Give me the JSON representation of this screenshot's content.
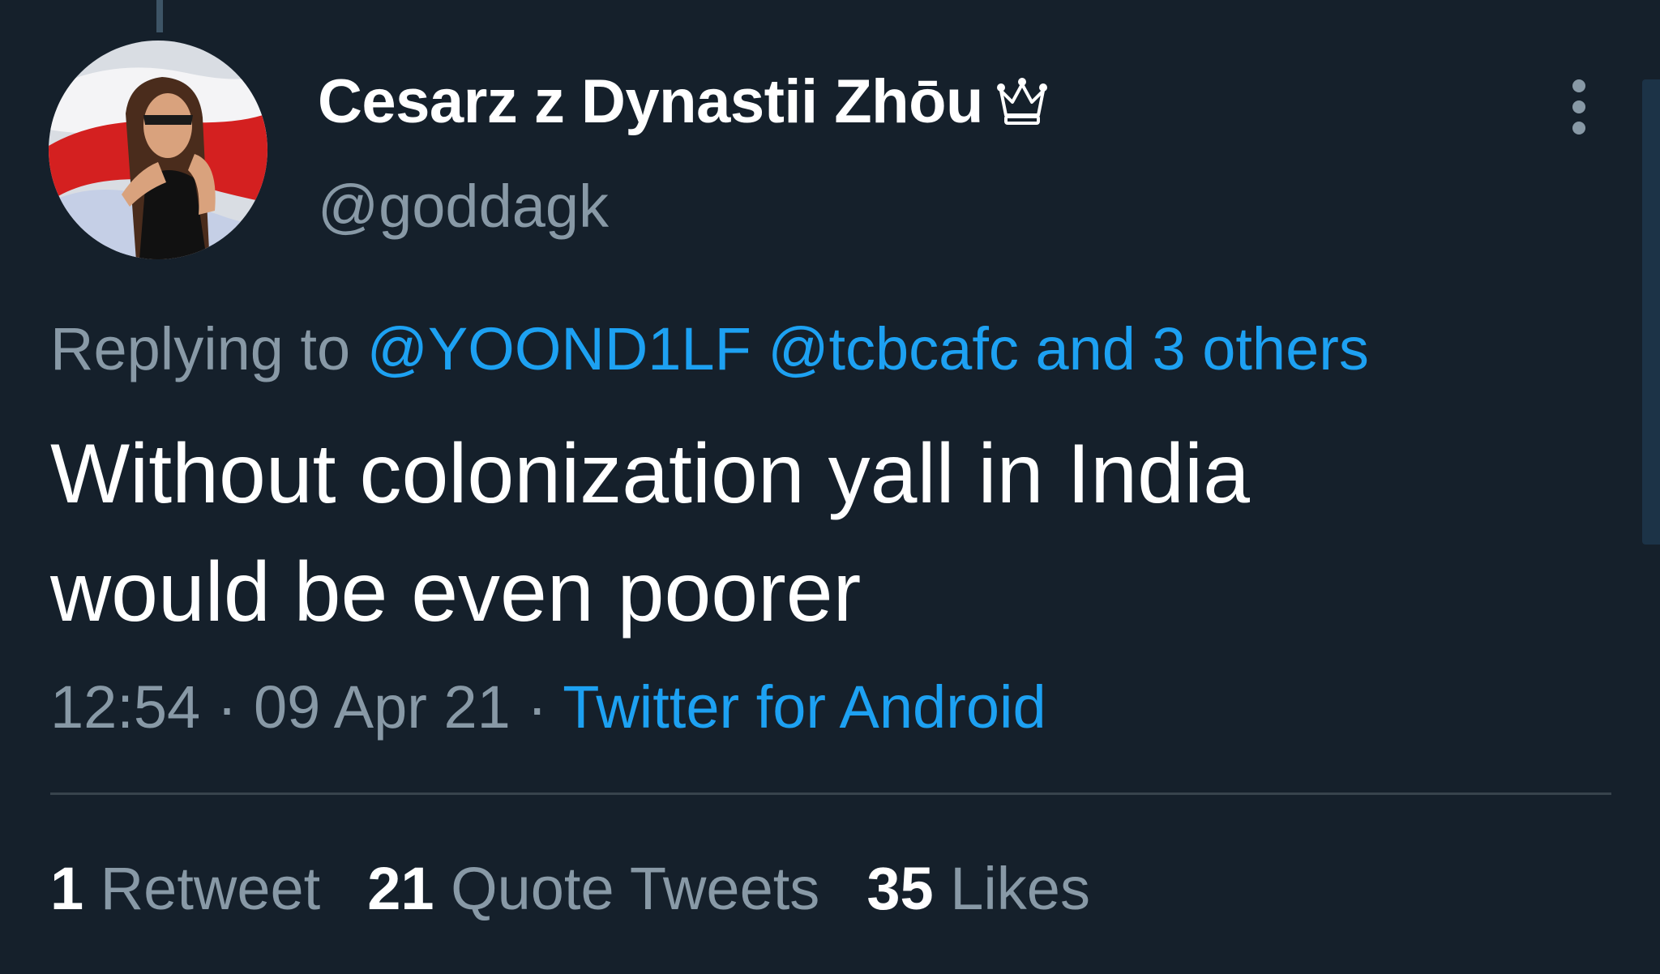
{
  "tweet": {
    "author": {
      "display_name": "Cesarz z Dynastii Zhōu",
      "handle": "@goddagk",
      "badge_icon": "crown-icon",
      "avatar": "profile-photo"
    },
    "reply": {
      "prefix": "Replying to",
      "mentions": [
        "@YOOND1LF",
        "@tcbcafc"
      ],
      "others": "and 3 others"
    },
    "text_lines": [
      "Without colonization yall in India",
      "would be even poorer"
    ],
    "time": "12:54",
    "date": "09 Apr 21",
    "separator": "·",
    "source": "Twitter for Android",
    "stats": {
      "retweets": {
        "count": "1",
        "label": "Retweet"
      },
      "quotes": {
        "count": "21",
        "label": "Quote Tweets"
      },
      "likes": {
        "count": "35",
        "label": "Likes"
      }
    }
  },
  "colors": {
    "background": "#15202b",
    "text_primary": "#ffffff",
    "text_secondary": "#8899a6",
    "link": "#1da1f2",
    "divider": "#38444d"
  }
}
